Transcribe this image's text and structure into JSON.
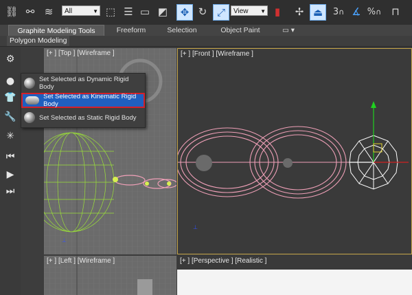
{
  "toolbar": {
    "selection_filter": "All",
    "reference_coord": "View",
    "snap_value": "3",
    "percent_symbol": "%",
    "icons": [
      "link-icon",
      "unlink-icon",
      "bind-space-warp-icon",
      "select-object-icon",
      "select-by-name-icon",
      "rectangular-region-icon",
      "window-crossing-icon",
      "select-move-icon",
      "select-rotate-icon",
      "select-scale-icon",
      "pivot-icon",
      "named-selection-icon",
      "mirror-icon",
      "align-icon",
      "snap-icon",
      "angle-snap-icon",
      "percent-snap-icon"
    ]
  },
  "ribbon": {
    "tabs": [
      "Graphite Modeling Tools",
      "Freeform",
      "Selection",
      "Object Paint"
    ],
    "active_tab": "Graphite Modeling Tools",
    "panel_label": "Polygon Modeling"
  },
  "viewports": {
    "top": "[+ ] [Top ] [Wireframe ]",
    "front": "[+ ] [Front ] [Wireframe ]",
    "left": "[+ ] [Left ] [Wireframe ]",
    "perspective": "[+ ] [Perspective ] [Realistic ]"
  },
  "flyout": {
    "items": [
      {
        "label": "Set Selected as Dynamic Rigid Body",
        "icon": "dynamic-rigid-body-icon"
      },
      {
        "label": "Set Selected as Kinematic Rigid Body",
        "icon": "kinematic-rigid-body-icon"
      },
      {
        "label": "Set Selected as Static Rigid Body",
        "icon": "static-rigid-body-icon"
      }
    ],
    "selected_index": 1
  },
  "colors": {
    "selection_highlight": "#1f5fbf",
    "selection_border": "#d4202a",
    "wire_pink": "#f0a0b8",
    "wire_green": "#9be038",
    "active_viewport_border": "#c8a84a"
  }
}
